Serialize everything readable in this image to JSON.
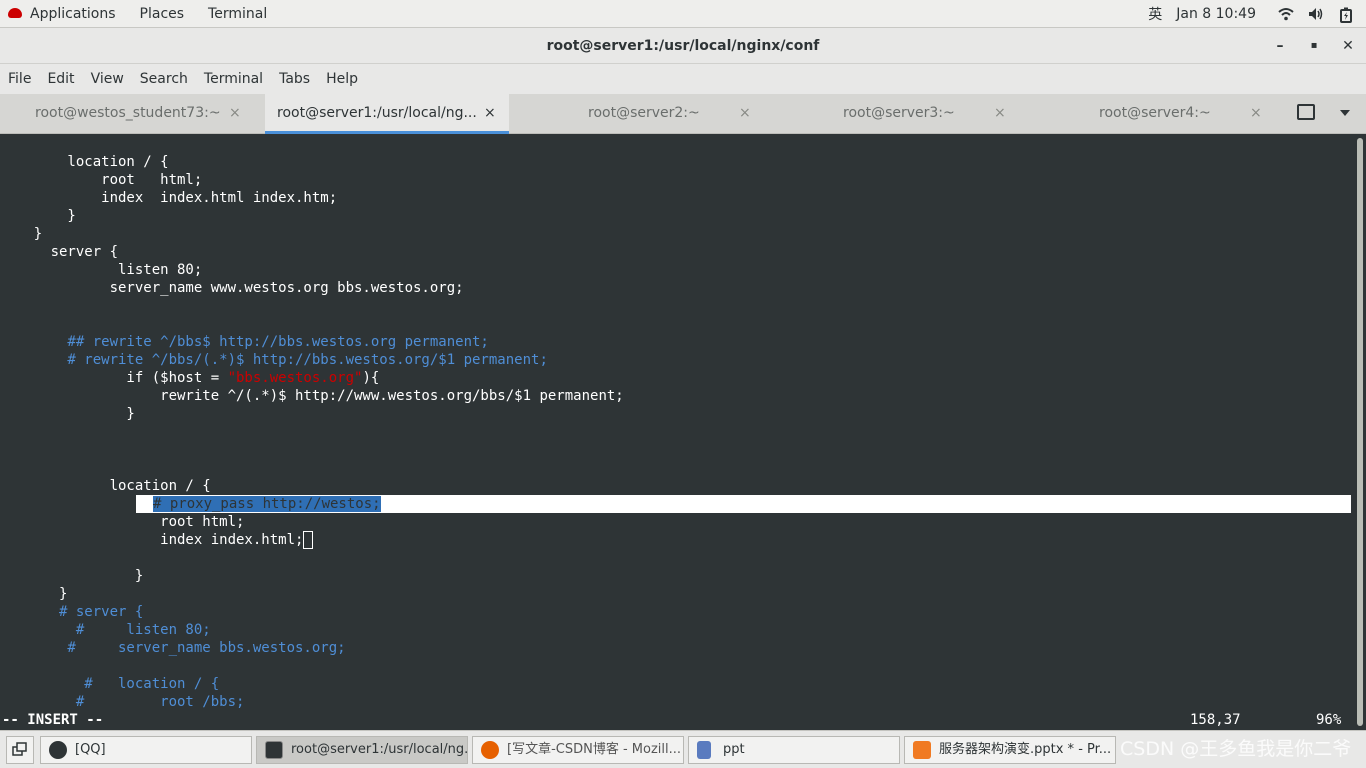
{
  "top_panel": {
    "applications": "Applications",
    "places": "Places",
    "terminal": "Terminal",
    "input_method": "英",
    "datetime": "Jan 8  10:49",
    "icons": [
      "wifi-icon",
      "volume-icon",
      "battery-icon"
    ]
  },
  "window": {
    "title": "root@server1:/usr/local/nginx/conf",
    "minimize": "–",
    "maximize": "▪",
    "close": "✕"
  },
  "menubar": [
    "File",
    "Edit",
    "View",
    "Search",
    "Terminal",
    "Tabs",
    "Help"
  ],
  "tabs": [
    {
      "label": "root@westos_student73:~",
      "close": "×"
    },
    {
      "label": "root@server1:/usr/local/ng...",
      "close": "×"
    },
    {
      "label": "root@server2:~",
      "close": "×"
    },
    {
      "label": "root@server3:~",
      "close": "×"
    },
    {
      "label": "root@server4:~",
      "close": "×"
    }
  ],
  "terminal": {
    "lines": [
      "        location / {",
      "            root   html;",
      "            index  index.html index.htm;",
      "        }",
      "    }",
      "      server {",
      "              listen 80;",
      "             server_name www.westos.org bbs.westos.org;",
      "",
      "",
      "        ## rewrite ^/bbs$ http://bbs.westos.org permanent;",
      "        # rewrite ^/bbs/(.*)$ http://bbs.westos.org/$1 permanent;",
      "               if ($host = \"bbs.westos.org\"){",
      "                   rewrite ^/(.*)$ http://www.westos.org/bbs/$1 permanent;",
      "               }",
      "",
      "",
      "",
      "             location / {",
      "                # proxy_pass http://westos;",
      "                   root html;",
      "                   index index.html;",
      "",
      "                }",
      "       }",
      "       # server {",
      "         #     listen 80;",
      "        #     server_name bbs.westos.org;",
      "",
      "          #   location / {",
      "         #         root /bbs;"
    ],
    "mode": "-- INSERT --",
    "position": "158,37",
    "percent": "96%"
  },
  "taskbar": [
    {
      "label": "[QQ]",
      "icon": "qq-penguin-icon"
    },
    {
      "label": "root@server1:/usr/local/ng...",
      "icon": "terminal-icon"
    },
    {
      "label": "[写文章-CSDN博客 - Mozill...",
      "icon": "firefox-icon"
    },
    {
      "label": "ppt",
      "icon": "document-icon"
    },
    {
      "label": "服务器架构演变.pptx * - Pr...",
      "icon": "presentation-icon"
    }
  ],
  "watermark": "CSDN @王多鱼我是你二爷",
  "colors": {
    "terminal_bg": "#2e3436",
    "comment": "#4f8ed6",
    "string": "#cc0000",
    "selection": "#2f6fb5",
    "tab_accent": "#4a90d9"
  }
}
